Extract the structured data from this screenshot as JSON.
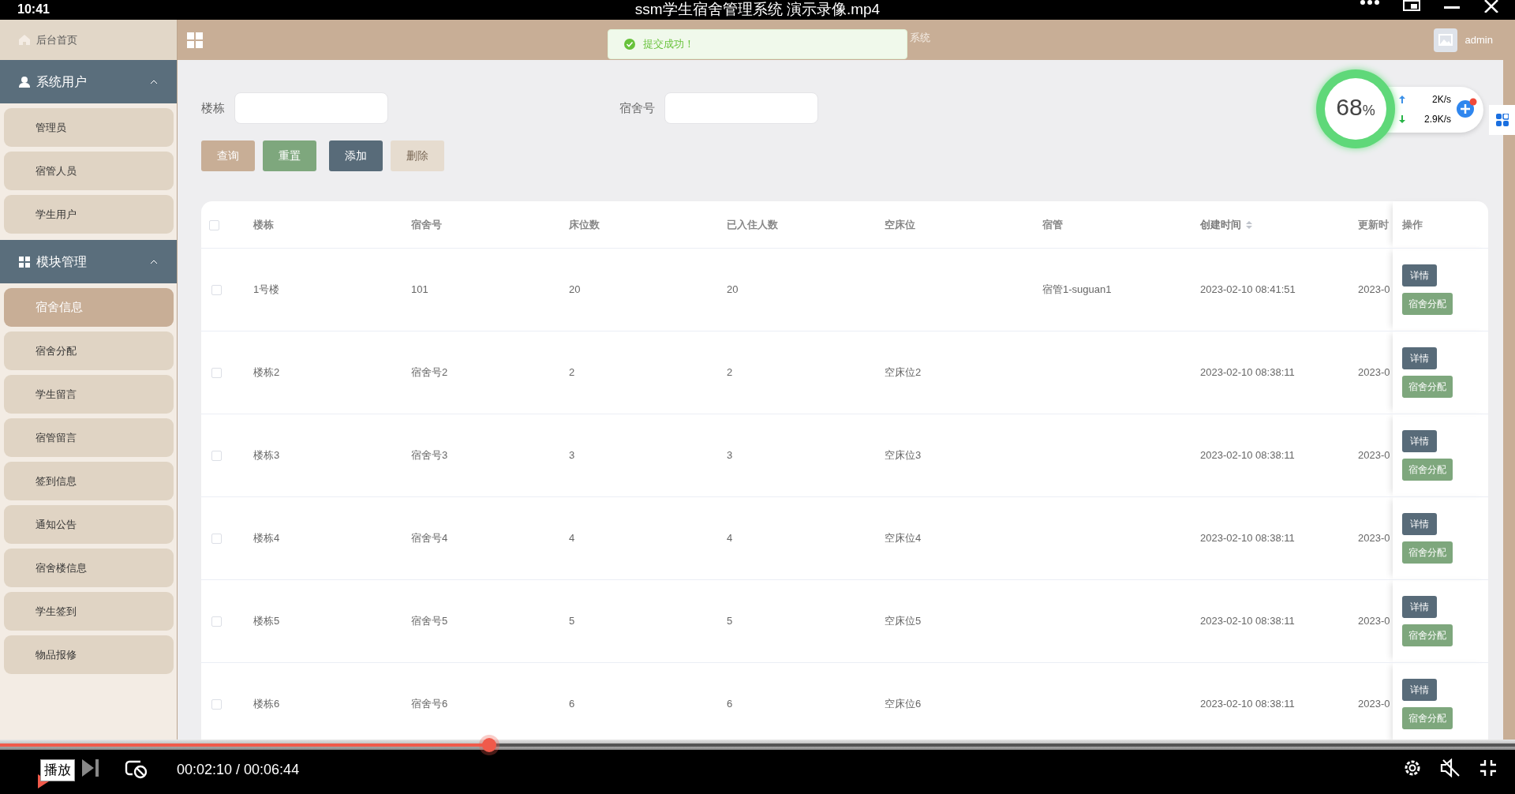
{
  "video": {
    "clock": "10:41",
    "title": "ssm学生宿舍管理系统 演示录像.mp4",
    "progress": {
      "level": 0.323
    },
    "tooltip": "播放",
    "time": "00:02:10 / 00:06:44"
  },
  "header": {
    "title": "系统",
    "user": "admin"
  },
  "toast": {
    "message": "提交成功！"
  },
  "sidebar": {
    "home": "后台首页",
    "groups": [
      {
        "label": "系统用户",
        "expanded": true,
        "items": [
          {
            "label": "管理员",
            "selected": false
          },
          {
            "label": "宿管人员",
            "selected": false
          },
          {
            "label": "学生用户",
            "selected": false
          }
        ]
      },
      {
        "label": "模块管理",
        "expanded": true,
        "items": [
          {
            "label": "宿舍信息",
            "selected": true
          },
          {
            "label": "宿舍分配",
            "selected": false
          },
          {
            "label": "学生留言",
            "selected": false
          },
          {
            "label": "宿管留言",
            "selected": false
          },
          {
            "label": "签到信息",
            "selected": false
          },
          {
            "label": "通知公告",
            "selected": false
          },
          {
            "label": "宿舍楼信息",
            "selected": false
          },
          {
            "label": "学生签到",
            "selected": false
          },
          {
            "label": "物品报修",
            "selected": false
          }
        ]
      }
    ]
  },
  "search": {
    "fields": [
      {
        "label": "楼栋"
      },
      {
        "label": "宿舍号"
      }
    ],
    "buttons": [
      {
        "label": "查询",
        "kind": "query",
        "disabled": false
      },
      {
        "label": "重置",
        "kind": "reset",
        "disabled": false
      },
      {
        "label": "添加",
        "kind": "add",
        "disabled": false
      },
      {
        "label": "删除",
        "kind": "delete",
        "disabled": true
      }
    ]
  },
  "table": {
    "all_checked": false,
    "columns": [
      {
        "label": "楼栋",
        "sortable": false
      },
      {
        "label": "宿舍号",
        "sortable": false
      },
      {
        "label": "床位数",
        "sortable": false
      },
      {
        "label": "已入住人数",
        "sortable": false
      },
      {
        "label": "空床位",
        "sortable": false
      },
      {
        "label": "宿管",
        "sortable": false
      },
      {
        "label": "创建时间",
        "sortable": true
      },
      {
        "label": "更新时",
        "sortable": false
      },
      {
        "label": "操作",
        "sortable": false
      }
    ],
    "rows": [
      {
        "checked": false,
        "cells": [
          "1号楼",
          "101",
          "20",
          "20",
          "",
          "宿管1-suguan1",
          "2023-02-10 08:41:51",
          "2023-0"
        ],
        "actions": [
          "详情",
          "宿舍分配"
        ]
      },
      {
        "checked": false,
        "cells": [
          "楼栋2",
          "宿舍号2",
          "2",
          "2",
          "空床位2",
          "",
          "2023-02-10 08:38:11",
          "2023-0"
        ],
        "actions": [
          "详情",
          "宿舍分配"
        ]
      },
      {
        "checked": false,
        "cells": [
          "楼栋3",
          "宿舍号3",
          "3",
          "3",
          "空床位3",
          "",
          "2023-02-10 08:38:11",
          "2023-0"
        ],
        "actions": [
          "详情",
          "宿舍分配"
        ]
      },
      {
        "checked": false,
        "cells": [
          "楼栋4",
          "宿舍号4",
          "4",
          "4",
          "空床位4",
          "",
          "2023-02-10 08:38:11",
          "2023-0"
        ],
        "actions": [
          "详情",
          "宿舍分配"
        ]
      },
      {
        "checked": false,
        "cells": [
          "楼栋5",
          "宿舍号5",
          "5",
          "5",
          "空床位5",
          "",
          "2023-02-10 08:38:11",
          "2023-0"
        ],
        "actions": [
          "详情",
          "宿舍分配"
        ]
      },
      {
        "checked": false,
        "cells": [
          "楼栋6",
          "宿舍号6",
          "6",
          "6",
          "空床位6",
          "",
          "2023-02-10 08:38:11",
          "2023-0"
        ],
        "actions": [
          "详情",
          "宿舍分配"
        ]
      }
    ]
  },
  "net_widget": {
    "percent": "68",
    "unit": "%",
    "up": "2K/s",
    "down": "2.9K/s"
  }
}
